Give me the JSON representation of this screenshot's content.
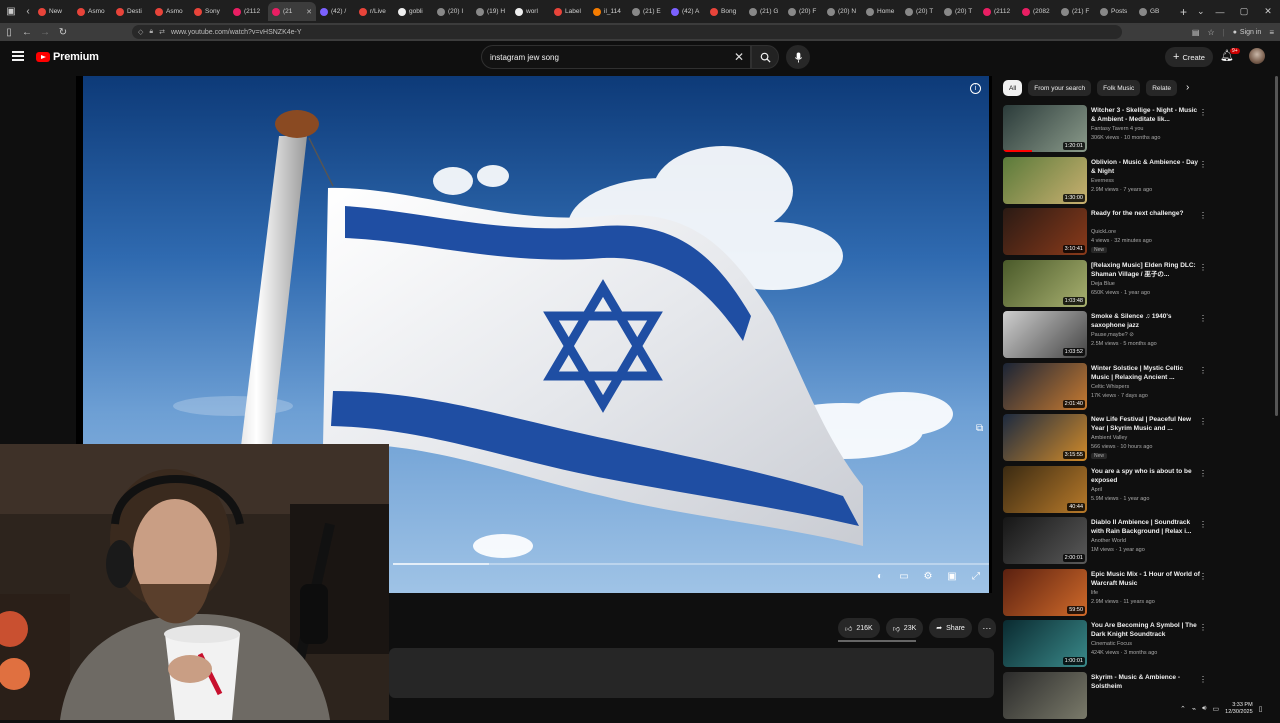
{
  "browser": {
    "tabs": [
      {
        "label": "New",
        "color": "#e8443a"
      },
      {
        "label": "Asmo",
        "color": "#e8443a"
      },
      {
        "label": "Desti",
        "color": "#e8443a"
      },
      {
        "label": "Asmo",
        "color": "#e8443a"
      },
      {
        "label": "Sony",
        "color": "#e8443a"
      },
      {
        "label": "(2112",
        "color": "#e91e63"
      },
      {
        "label": "(21",
        "color": "#e91e63",
        "active": true
      },
      {
        "label": "(42) /",
        "color": "#7b61ff"
      },
      {
        "label": "r/Live",
        "color": "#e8443a"
      },
      {
        "label": "gobli",
        "color": "#eeeeee"
      },
      {
        "label": "(20) I",
        "color": "#888888"
      },
      {
        "label": "(19) H",
        "color": "#888888"
      },
      {
        "label": "worl",
        "color": "#eeeeee"
      },
      {
        "label": "Label",
        "color": "#e8443a"
      },
      {
        "label": "il_114",
        "color": "#f57c00"
      },
      {
        "label": "(21) E",
        "color": "#888888"
      },
      {
        "label": "(42) A",
        "color": "#7b61ff"
      },
      {
        "label": "Bong",
        "color": "#e8443a"
      },
      {
        "label": "(21) G",
        "color": "#888888"
      },
      {
        "label": "(20) F",
        "color": "#888888"
      },
      {
        "label": "(20) N",
        "color": "#888888"
      },
      {
        "label": "Home",
        "color": "#888888"
      },
      {
        "label": "(20) T",
        "color": "#888888"
      },
      {
        "label": "(20) T",
        "color": "#888888"
      },
      {
        "label": "(2112",
        "color": "#e91e63"
      },
      {
        "label": "(2082",
        "color": "#e91e63"
      },
      {
        "label": "(21) F",
        "color": "#888888"
      },
      {
        "label": "Posts",
        "color": "#888888"
      },
      {
        "label": "GB",
        "color": "#888888"
      }
    ],
    "url": "www.youtube.com/watch?v=vHSNZK4e-Y",
    "signin_label": "Sign in"
  },
  "header": {
    "logo_text": "Premium",
    "search_value": "instagram jew song",
    "create_label": "Create",
    "notification_count": "9+"
  },
  "player": {
    "progress_fraction": 0.16
  },
  "actions": {
    "likes": "216K",
    "dislikes": "23K",
    "share_label": "Share"
  },
  "chips": [
    "All",
    "From your search",
    "Folk Music",
    "Relate"
  ],
  "related": [
    {
      "title": "Witcher 3 - Skellige - Night - Music & Ambient - Meditate lik...",
      "channel": "Fantasy Tavern 4 you",
      "meta": "306K views · 10 months ago",
      "duration": "1:20:01",
      "thumb": [
        "#2b3b3a",
        "#8a9a8a"
      ],
      "watched": 0.35
    },
    {
      "title": "Oblivion - Music & Ambience - Day & Night",
      "channel": "Everness",
      "meta": "2.9M views · 7 years ago",
      "duration": "1:30:00",
      "thumb": [
        "#5a7a3a",
        "#c9b070"
      ],
      "watched": 0
    },
    {
      "title": "Ready for the next challenge?",
      "channel": "QuickLore",
      "meta": "4 views · 32 minutes ago",
      "duration": "3:10:41",
      "thumb": [
        "#2a1a14",
        "#8a3a1a"
      ],
      "watched": 0,
      "new": "New"
    },
    {
      "title": "[Relaxing Music] Elden Ring DLC: Shaman Village / 巫子の...",
      "channel": "Deja Blue",
      "meta": "650K views · 1 year ago",
      "duration": "1:03:48",
      "thumb": [
        "#4a5a2a",
        "#a8b070"
      ],
      "watched": 0
    },
    {
      "title": "Smoke & Silence ♫ 1940's saxophone jazz",
      "channel": "Pause,maybe? ⊘",
      "meta": "2.5M views · 5 months ago",
      "duration": "1:03:52",
      "thumb": [
        "#cfcfcf",
        "#444444"
      ],
      "watched": 0
    },
    {
      "title": "Winter Solstice | Mystic Celtic Music | Relaxing Ancient ...",
      "channel": "Celtic Whispers",
      "meta": "17K views · 7 days ago",
      "duration": "2:01:40",
      "thumb": [
        "#1a2436",
        "#c77a30"
      ],
      "watched": 0
    },
    {
      "title": "New Life Festival | Peaceful New Year | Skyrim Music and ...",
      "channel": "Ambient Valley",
      "meta": "566 views · 10 hours ago",
      "duration": "3:15:55",
      "thumb": [
        "#1c2a40",
        "#d08a2a"
      ],
      "watched": 0,
      "new": "New"
    },
    {
      "title": "You are a spy who is about to be exposed",
      "channel": "April",
      "meta": "5.9M views · 1 year ago",
      "duration": "40:44",
      "thumb": [
        "#3a2a12",
        "#b87a2a"
      ],
      "watched": 0
    },
    {
      "title": "Diablo II Ambience | Soundtrack with Rain Background | Relax i...",
      "channel": "Another World",
      "meta": "1M views · 1 year ago",
      "duration": "2:00:01",
      "thumb": [
        "#161616",
        "#5a5a5a"
      ],
      "watched": 0
    },
    {
      "title": "Epic Music Mix - 1 Hour of World of Warcraft Music",
      "channel": "life",
      "meta": "2.9M views · 11 years ago",
      "duration": "59:50",
      "thumb": [
        "#5a2010",
        "#d06a2a"
      ],
      "watched": 0
    },
    {
      "title": "You Are Becoming A Symbol | The Dark Knight Soundtrack",
      "channel": "Cinematic Focus",
      "meta": "424K views · 3 months ago",
      "duration": "1:00:01",
      "thumb": [
        "#0a2a30",
        "#3a8a8a"
      ],
      "watched": 0
    },
    {
      "title": "Skyrim - Music & Ambience - Solstheim",
      "channel": "",
      "meta": "",
      "duration": "",
      "thumb": [
        "#2a2a2a",
        "#7a7a6a"
      ],
      "watched": 0
    }
  ],
  "taskbar": {
    "time": "3:33 PM",
    "date": "12/30/2025"
  },
  "colors": {
    "accent": "#ff0000",
    "flag_blue": "#1f4ea3",
    "flag_white": "#f4f4f4"
  }
}
